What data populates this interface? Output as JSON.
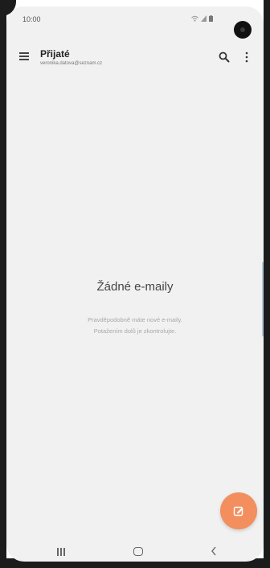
{
  "status_bar": {
    "time": "10:00",
    "icons": [
      "wifi-icon",
      "signal-icon",
      "battery-icon"
    ]
  },
  "header": {
    "title": "Přijaté",
    "account": "veronika.datova@seznam.cz",
    "menu_icon": "hamburger-menu-icon",
    "search_icon": "search-icon",
    "more_icon": "more-vertical-icon"
  },
  "empty_state": {
    "title": "Žádné e-maily",
    "line1": "Pravděpodobně máte nové e-maily.",
    "line2": "Potažením dolů je zkontrolujte."
  },
  "fab": {
    "icon": "compose-icon",
    "color": "#f38f5f"
  },
  "nav_bar": {
    "recents_icon": "recents-icon",
    "home_icon": "home-icon",
    "back_icon": "back-icon"
  },
  "colors": {
    "background": "#f1f1f1",
    "accent": "#f38f5f"
  }
}
